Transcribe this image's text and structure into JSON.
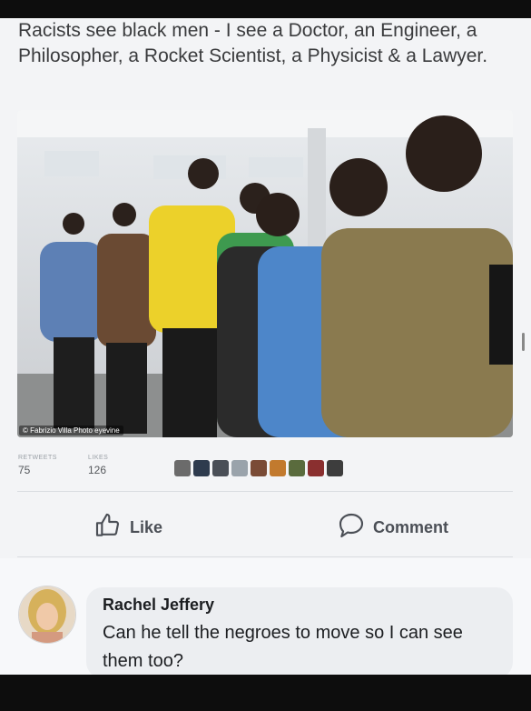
{
  "post": {
    "text": "Racists see black men - I see a Doctor, an Engineer, a Philosopher, a Rocket Scientist, a Physicist & a Lawyer.",
    "photo_credit": "© Fabrizio Villa Photo eyevine"
  },
  "stats": {
    "retweets_label": "RETWEETS",
    "retweets_value": "75",
    "likes_label": "LIKES",
    "likes_value": "126"
  },
  "actions": {
    "like_label": "Like",
    "comment_label": "Comment"
  },
  "comment": {
    "author": "Rachel Jeffery",
    "text": "Can he tell the negroes to move so I can see them too?"
  },
  "colors": {
    "action_text": "#4b4f56",
    "bubble": "#eceef1"
  },
  "icons": [
    "like-thumb-icon",
    "comment-bubble-icon"
  ]
}
